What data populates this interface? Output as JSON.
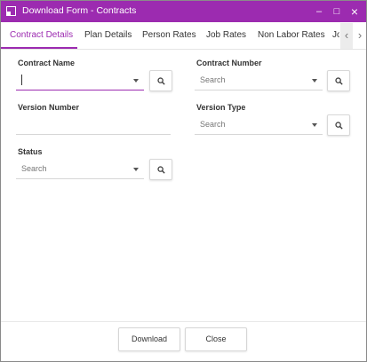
{
  "window": {
    "title": "Download Form - Contracts",
    "controls": {
      "minimize": "–",
      "maximize": "□",
      "close": "×"
    }
  },
  "tabs": [
    {
      "label": "Contract Details",
      "active": true
    },
    {
      "label": "Plan Details"
    },
    {
      "label": "Person Rates"
    },
    {
      "label": "Job Rates"
    },
    {
      "label": "Non Labor Rates"
    },
    {
      "label": "Jo"
    }
  ],
  "tab_scroll": {
    "left": "‹",
    "right": "›"
  },
  "form": {
    "contract_name": {
      "label": "Contract Name",
      "value": ""
    },
    "contract_number": {
      "label": "Contract Number",
      "placeholder": "Search"
    },
    "version_number": {
      "label": "Version Number",
      "value": ""
    },
    "version_type": {
      "label": "Version Type",
      "placeholder": "Search"
    },
    "status": {
      "label": "Status",
      "placeholder": "Search"
    }
  },
  "footer": {
    "download_label": "Download",
    "close_label": "Close"
  },
  "colors": {
    "accent": "#9c2bb0"
  },
  "icons": {
    "search": "search-icon",
    "dropdown": "dropdown-arrow-icon",
    "app": "app-window-icon"
  }
}
